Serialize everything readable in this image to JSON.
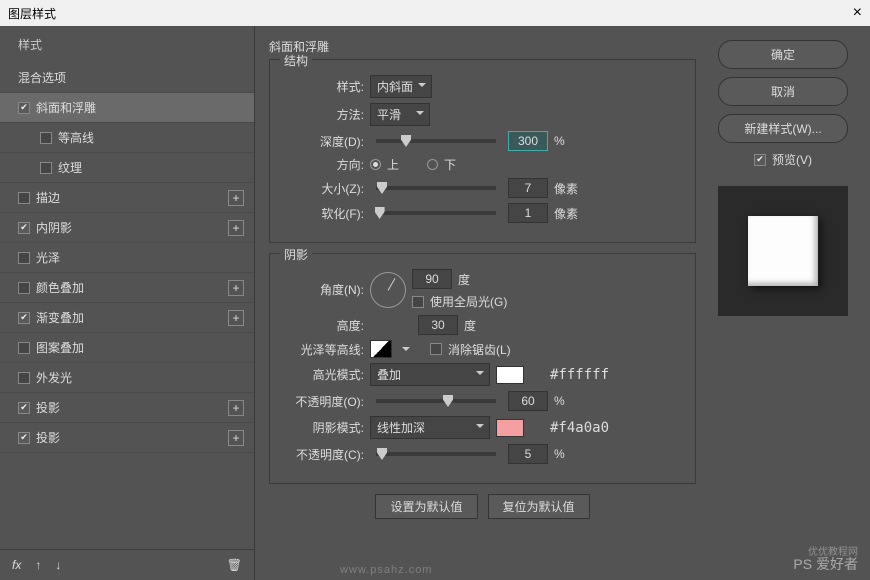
{
  "title": "图层样式",
  "sidebar": {
    "styles_header": "样式",
    "blend_header": "混合选项",
    "items": [
      {
        "label": "斜面和浮雕",
        "checked": true,
        "active": true,
        "plus": false,
        "sub": false
      },
      {
        "label": "等高线",
        "checked": false,
        "active": false,
        "plus": false,
        "sub": true
      },
      {
        "label": "纹理",
        "checked": false,
        "active": false,
        "plus": false,
        "sub": true
      },
      {
        "label": "描边",
        "checked": false,
        "active": false,
        "plus": true,
        "sub": false
      },
      {
        "label": "内阴影",
        "checked": true,
        "active": false,
        "plus": true,
        "sub": false
      },
      {
        "label": "光泽",
        "checked": false,
        "active": false,
        "plus": false,
        "sub": false
      },
      {
        "label": "颜色叠加",
        "checked": false,
        "active": false,
        "plus": true,
        "sub": false
      },
      {
        "label": "渐变叠加",
        "checked": true,
        "active": false,
        "plus": true,
        "sub": false
      },
      {
        "label": "图案叠加",
        "checked": false,
        "active": false,
        "plus": false,
        "sub": false
      },
      {
        "label": "外发光",
        "checked": false,
        "active": false,
        "plus": false,
        "sub": false
      },
      {
        "label": "投影",
        "checked": true,
        "active": false,
        "plus": true,
        "sub": false
      },
      {
        "label": "投影",
        "checked": true,
        "active": false,
        "plus": true,
        "sub": false
      }
    ],
    "fx": "fx"
  },
  "panel": {
    "title": "斜面和浮雕",
    "struct": {
      "legend": "结构",
      "style_label": "样式:",
      "style_value": "内斜面",
      "method_label": "方法:",
      "method_value": "平滑",
      "depth_label": "深度(D):",
      "depth_value": "300",
      "depth_unit": "%",
      "dir_label": "方向:",
      "dir_up": "上",
      "dir_down": "下",
      "size_label": "大小(Z):",
      "size_value": "7",
      "size_unit": "像素",
      "soften_label": "软化(F):",
      "soften_value": "1",
      "soften_unit": "像素"
    },
    "shadow": {
      "legend": "阴影",
      "angle_label": "角度(N):",
      "angle_value": "90",
      "angle_unit": "度",
      "global_label": "使用全局光(G)",
      "alt_label": "高度:",
      "alt_value": "30",
      "alt_unit": "度",
      "gloss_label": "光泽等高线:",
      "antialias_label": "消除锯齿(L)",
      "hilite_mode_label": "高光模式:",
      "hilite_mode_value": "叠加",
      "hilite_color": "#ffffff",
      "hilite_color_text": "#ffffff",
      "hilite_op_label": "不透明度(O):",
      "hilite_op_value": "60",
      "hilite_op_unit": "%",
      "shadow_mode_label": "阴影模式:",
      "shadow_mode_value": "线性加深",
      "shadow_color": "#f4a0a0",
      "shadow_color_text": "#f4a0a0",
      "shadow_op_label": "不透明度(C):",
      "shadow_op_value": "5",
      "shadow_op_unit": "%"
    },
    "footer": {
      "default_btn": "设置为默认值",
      "reset_btn": "复位为默认值"
    }
  },
  "right": {
    "ok": "确定",
    "cancel": "取消",
    "new_style": "新建样式(W)...",
    "preview": "预览(V)"
  },
  "watermark": "PS 爱好者",
  "watermark2": "优优教程网",
  "wm_url": "www.psahz.com"
}
